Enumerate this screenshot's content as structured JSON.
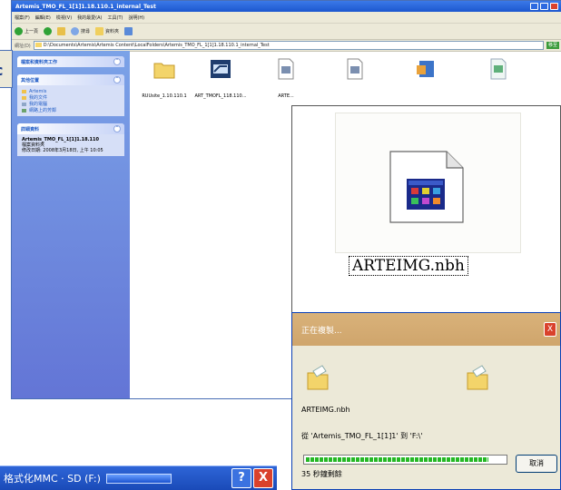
{
  "explorer": {
    "title": "Artemis_TMO_FL_1[1]1.18.110.1_internal_Test",
    "menu": [
      "檔案(F)",
      "編輯(E)",
      "檢視(V)",
      "我的最愛(A)",
      "工具(T)",
      "說明(H)"
    ],
    "toolbar": {
      "back": "上一頁",
      "search": "搜尋",
      "folders": "資料夾"
    },
    "address_label": "網址(D)",
    "address": "D:\\Documents\\Artemis\\Artemis Content\\LocalFolders\\Artemis_TMO_FL_1[1]1.18.110.1_internal_Test",
    "go_label": "移至",
    "left_panel": {
      "tasks_title": "檔案和資料夾工作",
      "places_title": "其他位置",
      "places": [
        "Artemis",
        "我的文件",
        "我的電腦",
        "網路上的芳鄰"
      ],
      "details_title": "詳細資料",
      "details_name": "Artemis_TMO_FL_1[1]1.18.110",
      "details_type": "檔案資料夾",
      "details_modified": "修改日期: 2008年3月18日, 上午 10:05"
    },
    "files": [
      {
        "label": "RUUsite_1.10.110.1",
        "icon": "folder-icon"
      },
      {
        "label": "ART_TMOFL_118.110...",
        "icon": "exe-icon"
      },
      {
        "label": "ARTE...",
        "icon": "dll-icon"
      },
      {
        "label": "",
        "icon": "dll-icon"
      },
      {
        "label": "",
        "icon": "setup-icon"
      },
      {
        "label": "",
        "icon": "image-icon"
      }
    ]
  },
  "preview": {
    "filename": "ARTEIMG.nbh"
  },
  "copying": {
    "title": "正在複製...",
    "file": "ARTEIMG.nbh",
    "from": "從 'Artemis_TMO_FL_1[1]1' 到 'F:\\'",
    "remaining": "35 秒鐘剩餘",
    "cancel": "取消",
    "progress": 0.92
  },
  "format_dialog": {
    "title": "格式化MMC · SD (F:)",
    "help": "?",
    "close": "X"
  },
  "clipped_label": "c"
}
